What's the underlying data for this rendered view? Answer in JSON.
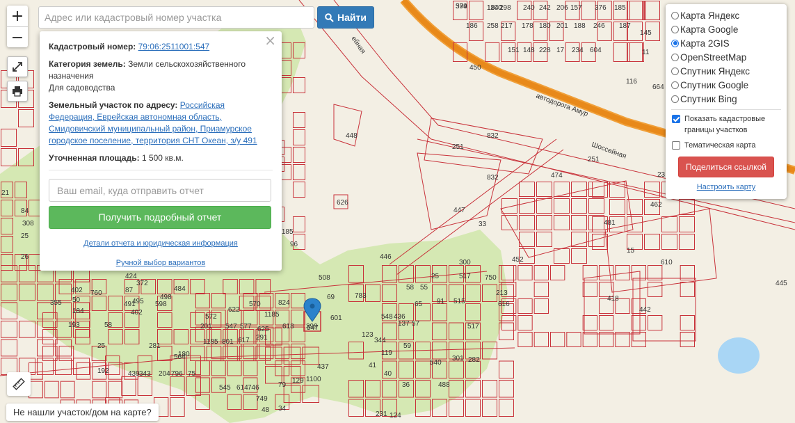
{
  "search": {
    "placeholder": "Адрес или кадастровый номер участка",
    "button_label": "Найти"
  },
  "zoom": {
    "in": "+",
    "out": "−"
  },
  "tools": {
    "fullscreen_icon": "expand-icon",
    "print_icon": "printer-icon",
    "ruler_icon": "ruler-icon"
  },
  "popup": {
    "cadastral_label": "Кадастровый номер:",
    "cadastral_value": "79:06:2511001:547",
    "category_label": "Категория земель:",
    "category_value": "Земли сельскохозяйственного назначения",
    "usage": "Для садоводства",
    "address_label": "Земельный участок по адресу:",
    "address_value": "Российская Федерация, Еврейская автономная область, Смидовичский муниципальный район, Приамурское городское поселение, территория СНТ Океан, з/у 491",
    "area_label": "Уточненная площадь:",
    "area_value": "1 500 кв.м.",
    "email_placeholder": "Ваш email, куда отправить отчет",
    "report_button": "Получить подробный отчет",
    "details_link": "Детали отчета и юридическая информация",
    "manual_link": "Ручной выбор вариантов"
  },
  "layers": {
    "options": [
      {
        "label": "Карта Яндекс",
        "selected": false
      },
      {
        "label": "Карта Google",
        "selected": false
      },
      {
        "label": "Карта 2GIS",
        "selected": true
      },
      {
        "label": "OpenStreetMap",
        "selected": false
      },
      {
        "label": "Спутник Яндекс",
        "selected": false
      },
      {
        "label": "Спутник Google",
        "selected": false
      },
      {
        "label": "Спутник Bing",
        "selected": false
      }
    ],
    "show_borders": "Показать кадастровые границы участков",
    "show_borders_checked": true,
    "thematic": "Тематическая карта",
    "thematic_checked": false,
    "share_button": "Поделиться ссылкой",
    "config_link": "Настроить карту"
  },
  "not_found": "Не нашли участок/дом на карте?",
  "map": {
    "road_label": "автодорога Амур",
    "street_label": "Шоссейная",
    "street_label_2": "ейная",
    "marker_label": "547",
    "colors": {
      "parcel_border": "#c8323a",
      "garden": "#d5e8b3",
      "road": "#f08c00",
      "water": "#a9d6f5",
      "background": "#f3efe4"
    },
    "parcel_numbers": [
      "374",
      "184",
      "198",
      "240",
      "242",
      "206",
      "157",
      "376",
      "185",
      "186",
      "258",
      "217",
      "178",
      "180",
      "201",
      "188",
      "246",
      "187",
      "145",
      "151",
      "148",
      "228",
      "17",
      "234",
      "604",
      "11",
      "450",
      "664",
      "832",
      "251",
      "251",
      "23",
      "832",
      "474",
      "462",
      "448",
      "447",
      "33",
      "481",
      "15",
      "610",
      "626",
      "452",
      "445",
      "446",
      "300",
      "508",
      "418",
      "442",
      "760",
      "598",
      "824",
      "1185",
      "783",
      "750",
      "213",
      "616",
      "193",
      "201",
      "572",
      "547",
      "577",
      "625",
      "618",
      "399",
      "281",
      "1185",
      "801",
      "617",
      "291",
      "564",
      "192",
      "439",
      "343",
      "204",
      "796",
      "75",
      "545",
      "614",
      "746",
      "749",
      "79",
      "129",
      "1100",
      "437",
      "48",
      "34",
      "231",
      "69",
      "601",
      "622",
      "570",
      "282",
      "301",
      "488",
      "540",
      "517",
      "548",
      "137",
      "123",
      "344",
      "119",
      "41",
      "40",
      "36",
      "59",
      "21",
      "84",
      "308",
      "25",
      "26",
      "402",
      "50",
      "184",
      "355",
      "180",
      "25",
      "1185",
      "96",
      "58",
      "402",
      "424",
      "87",
      "491",
      "372",
      "495",
      "484",
      "498",
      "436",
      "57",
      "65",
      "55",
      "91",
      "515",
      "517",
      "25",
      "58",
      "124",
      "116",
      "599",
      "1100",
      "2"
    ]
  }
}
